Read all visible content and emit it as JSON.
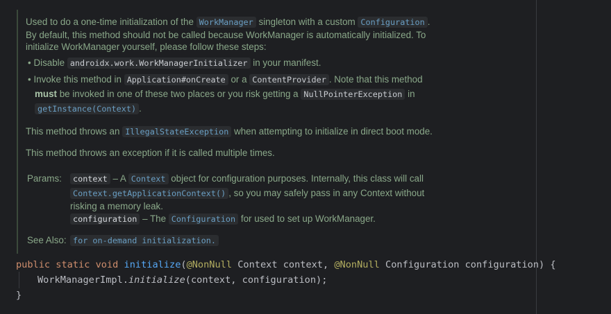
{
  "doc": {
    "p1_a": "Used to do a one-time initialization of the ",
    "p1_code1": "WorkManager",
    "p1_b": " singleton with a custom ",
    "p1_code2": "Configuration",
    "p1_c": ".",
    "p2_line1": "By default, this method should not be called because WorkManager is automatically initialized. To",
    "p2_line2": "initialize WorkManager yourself, please follow these steps:",
    "b1_a": "Disable ",
    "b1_code": "androidx.work.WorkManagerInitializer",
    "b1_b": " in your manifest.",
    "b2_a": "Invoke this method in ",
    "b2_code1": "Application#onCreate",
    "b2_b": " or a ",
    "b2_code2": "ContentProvider",
    "b2_c": ". Note that this method",
    "b2_bold": "must",
    "b2_d": " be invoked in one of these two places or you risk getting a ",
    "b2_code3": "NullPointerException",
    "b2_e": " in",
    "b2_code4": "getInstance(Context)",
    "b2_f": ".",
    "p3_a": "This method throws an ",
    "p3_code": "IllegalStateException",
    "p3_b": " when attempting to initialize in direct boot mode.",
    "p4": "This method throws an exception if it is called multiple times.",
    "params_label": "Params:",
    "param1_name": "context",
    "param1_a": " – A ",
    "param1_code": "Context",
    "param1_b": " object for configuration purposes. Internally, this class will call",
    "param1_code2": "Context.getApplicationContext()",
    "param1_c": ", so you may safely pass in any Context without",
    "param1_d": "risking a memory leak.",
    "param2_name": "configuration",
    "param2_a": " – The ",
    "param2_code": "Configuration",
    "param2_b": " for used to set up WorkManager.",
    "seealso_label": "See Also:",
    "seealso_link": "for on-demand initialization."
  },
  "code": {
    "l1_public": "public",
    "l1_static": "static",
    "l1_void": "void",
    "l1_fn": "initialize",
    "l1_paren": "(",
    "l1_ann1": "@NonNull",
    "l1_p1": " Context context, ",
    "l1_ann2": "@NonNull",
    "l1_p2": " Configuration configuration) {",
    "l2_a": "WorkManagerImpl.",
    "l2_fn": "initialize",
    "l2_b": "(context, configuration);",
    "l3": "}"
  },
  "colors": {
    "background": "#1e1f22",
    "doc_text": "#8aa889",
    "link": "#6a9fc4",
    "keyword": "#cf8e6d",
    "function": "#56a8f5",
    "annotation": "#b3ae60"
  }
}
